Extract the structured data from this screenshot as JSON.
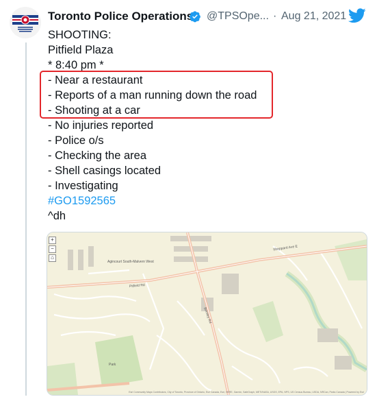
{
  "tweet": {
    "display_name": "Toronto Police Operations",
    "handle": "@TPSOpe...",
    "separator": "·",
    "date": "Aug 21, 2021",
    "lines": [
      "SHOOTING:",
      "Pitfield Plaza",
      "* 8:40 pm *",
      "- Near a restaurant",
      "- Reports of a man running down the road",
      "- Shooting at a car",
      "- No injuries reported",
      "- Police o/s",
      "- Checking the area",
      "- Shell casings located",
      "- Investigating"
    ],
    "hashtag": "#GO1592565",
    "signoff": "^dh"
  },
  "avatar_text": "TORONTO POLICE OPERATIONAL CENTRE",
  "icons": {
    "verified": "verified-badge-icon",
    "twitter": "twitter-bird-icon",
    "zoom_in": "+",
    "zoom_out": "−",
    "home": "⌂"
  },
  "map": {
    "labels": {
      "area": "Agincourt South-Malvern West",
      "street_1": "Brimley Rd",
      "street_2": "Sheppard Ave E",
      "street_3": "Pitfield Rd",
      "park": "Park"
    },
    "attribution": "Esri Community Maps Contributors, City of Toronto, Province of Ontario, Esri Canada, Esri, HERE, Garmin, SafeGraph, METI/NASA, USGS, EPA, NPS, US Census Bureau, USDA, NRCan, Parks Canada | Powered by Esri"
  },
  "colors": {
    "accent": "#1d9bf0",
    "highlight": "#e3262b",
    "text": "#0f1419",
    "muted": "#536471",
    "map_bg": "#f4f1dd",
    "map_road": "#f3c3a9",
    "map_green": "#cfe3b7",
    "map_water": "#a6d6e8"
  }
}
